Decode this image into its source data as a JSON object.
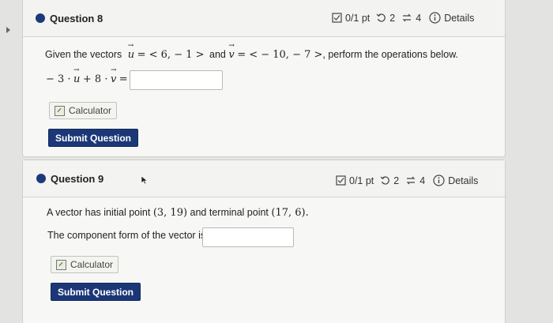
{
  "q8": {
    "title": "Question 8",
    "score": "0/1 pt",
    "attempts": "2",
    "tries": "4",
    "details": "Details",
    "prompt_pre": "Given the vectors",
    "u_def": "⃗u = < 6, − 1 >",
    "u_var": "u",
    "u_val": "= < 6, − 1 >",
    "and": "and",
    "v_var": "v",
    "v_val": "= < − 10, − 7 >",
    "prompt_post": ", perform the operations below.",
    "expr": "− 3 · u + 8 · v =",
    "expr_a": "− 3 ·",
    "expr_u": "u",
    "expr_b": "+ 8 ·",
    "expr_v": "v",
    "expr_c": "=",
    "answer_value": "",
    "calculator_label": "Calculator",
    "submit_label": "Submit Question"
  },
  "q9": {
    "title": "Question 9",
    "score": "0/1 pt",
    "attempts": "2",
    "tries": "4",
    "details": "Details",
    "prompt_a": "A vector has initial point",
    "initial_point": "(3, 19)",
    "prompt_b": "and terminal point",
    "terminal_point": "(17, 6)",
    "prompt_c": ".",
    "component_label": "The component form of the vector is:",
    "answer_value": "",
    "calculator_label": "Calculator",
    "submit_label": "Submit Question"
  },
  "colors": {
    "accent": "#1c3777",
    "dot": "#1b3a7a",
    "background": "#e3e3e1",
    "card": "#f7f7f5"
  },
  "icons": [
    "score-icon",
    "retry-icon",
    "tries-icon",
    "info-icon",
    "calculator-icon",
    "question-dot-icon",
    "cursor-icon",
    "expand-arrow-icon"
  ]
}
